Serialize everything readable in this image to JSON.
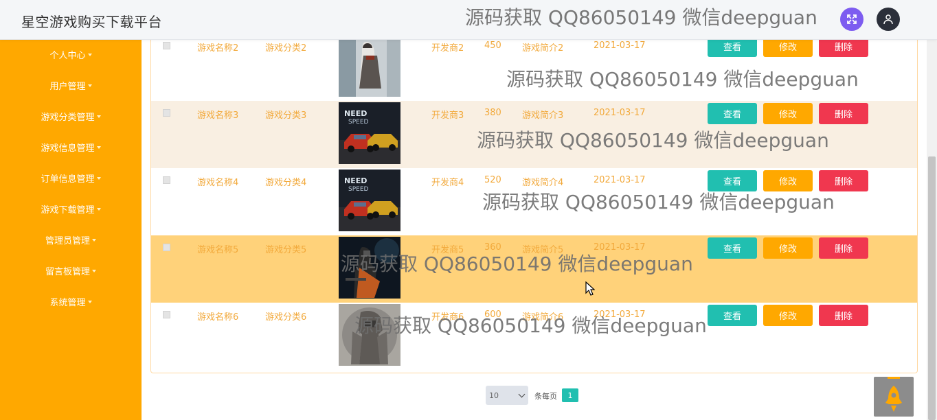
{
  "header": {
    "title": "星空游戏购买下载平台",
    "watermark": "源码获取 QQ86050149 微信deepguan",
    "fullscreen_icon": "fullscreen-icon",
    "user_icon": "user-icon",
    "colors": {
      "fullscreen": "#7d5cf0",
      "user": "#2b2f3a"
    }
  },
  "sidebar": {
    "bg_color": "#ffa800",
    "items": [
      {
        "label": "个人中心"
      },
      {
        "label": "用户管理"
      },
      {
        "label": "游戏分类管理"
      },
      {
        "label": "游戏信息管理"
      },
      {
        "label": "订单信息管理"
      },
      {
        "label": "游戏下载管理"
      },
      {
        "label": "管理员管理"
      },
      {
        "label": "留言板管理"
      },
      {
        "label": "系统管理"
      }
    ]
  },
  "table": {
    "actions": {
      "view": "查看",
      "edit": "修改",
      "delete": "删除"
    },
    "rows": [
      {
        "name": "游戏名称2",
        "category": "游戏分类2",
        "developer": "开发商2",
        "price": "450",
        "intro": "游戏简介2",
        "date": "2021-03-17",
        "highlight": false,
        "alt": false,
        "image": "assassin"
      },
      {
        "name": "游戏名称3",
        "category": "游戏分类3",
        "developer": "开发商3",
        "price": "380",
        "intro": "游戏简介3",
        "date": "2021-03-17",
        "highlight": false,
        "alt": true,
        "image": "racing"
      },
      {
        "name": "游戏名称4",
        "category": "游戏分类4",
        "developer": "开发商4",
        "price": "520",
        "intro": "游戏简介4",
        "date": "2021-03-17",
        "highlight": false,
        "alt": false,
        "image": "racing"
      },
      {
        "name": "游戏名称5",
        "category": "游戏分类5",
        "developer": "开发商5",
        "price": "360",
        "intro": "游戏简介5",
        "date": "2021-03-17",
        "highlight": true,
        "alt": false,
        "image": "soldier"
      },
      {
        "name": "游戏名称6",
        "category": "游戏分类6",
        "developer": "开发商6",
        "price": "600",
        "intro": "游戏简介6",
        "date": "2021-03-17",
        "highlight": false,
        "alt": false,
        "image": "armor"
      }
    ],
    "colors": {
      "alt_row": "#f9efe2",
      "highlight_row": "#ffd27a",
      "text": "#f2a93b",
      "view": "#21bfb0",
      "edit": "#ffa800",
      "delete": "#f0374f"
    }
  },
  "pagination": {
    "page_size": "10",
    "per_page_label": "条每页",
    "current_page": "1"
  },
  "watermark": "源码获取 QQ86050149 微信deepguan",
  "rocket_icon": "rocket-icon"
}
